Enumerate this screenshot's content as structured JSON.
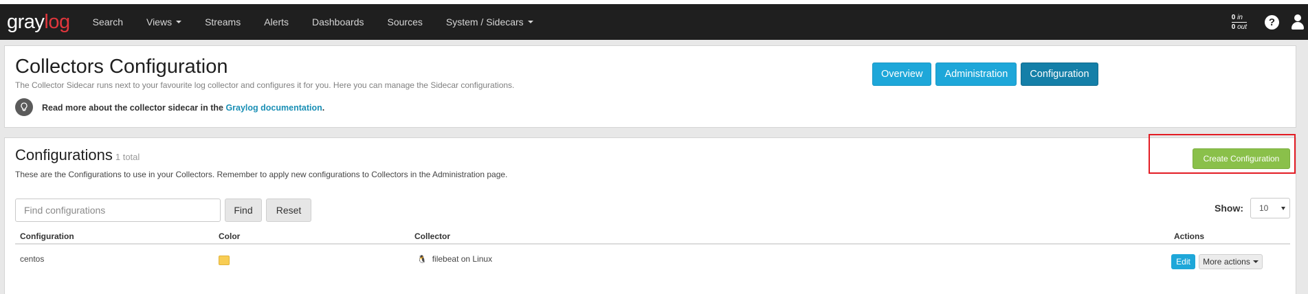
{
  "brand": {
    "part1": "gray",
    "part2": "log"
  },
  "nav": {
    "items": [
      {
        "label": "Search",
        "dropdown": false
      },
      {
        "label": "Views",
        "dropdown": true
      },
      {
        "label": "Streams",
        "dropdown": false
      },
      {
        "label": "Alerts",
        "dropdown": false
      },
      {
        "label": "Dashboards",
        "dropdown": false
      },
      {
        "label": "Sources",
        "dropdown": false
      },
      {
        "label": "System / Sidecars",
        "dropdown": true
      }
    ],
    "throughput": {
      "in_value": "0",
      "in_label": "in",
      "out_value": "0",
      "out_label": "out"
    },
    "help_icon": "question-circle-icon",
    "user_icon": "user-icon"
  },
  "header": {
    "title": "Collectors Configuration",
    "description": "The Collector Sidecar runs next to your favourite log collector and configures it for you. Here you can manage the Sidecar configurations.",
    "readmore_prefix": "Read more about the collector sidecar in the",
    "readmore_link": "Graylog documentation",
    "readmore_suffix": ".",
    "buttons": {
      "overview": "Overview",
      "administration": "Administration",
      "configuration": "Configuration"
    }
  },
  "configurations": {
    "title": "Configurations",
    "count": "1 total",
    "description": "These are the Configurations to use in your Collectors. Remember to apply new configurations to Collectors in the Administration page.",
    "create_label": "Create Configuration",
    "search": {
      "placeholder": "Find configurations",
      "value": ""
    },
    "find_label": "Find",
    "reset_label": "Reset",
    "show_label": "Show:",
    "show_value": "10",
    "columns": [
      "Configuration",
      "Color",
      "Collector",
      "Actions"
    ],
    "rows": [
      {
        "name": "centos",
        "color": "#f8cd54",
        "collector": "filebeat on Linux",
        "edit_label": "Edit",
        "more_label": "More actions"
      }
    ]
  },
  "colors": {
    "navbar": "#1f1f1f",
    "primary": "#1ea7d9",
    "success": "#8ac04a",
    "brand_accent": "#e0363c",
    "highlight": "#e31b23"
  }
}
